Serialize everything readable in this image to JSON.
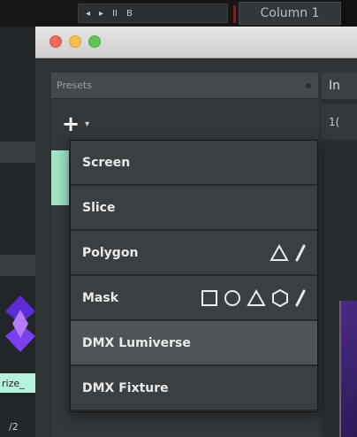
{
  "background": {
    "transport": {
      "prev": "◂",
      "next": "▸",
      "pause": "II",
      "stop": "B"
    },
    "column_tab": "Column 1",
    "left_tag": "rize_",
    "left_number": "/2",
    "right_header": "In",
    "right_value": "1("
  },
  "presets": {
    "header_label": "Presets",
    "add_symbol": "+",
    "add_caret": "▾"
  },
  "menu": {
    "items": [
      {
        "label": "Screen",
        "icons": []
      },
      {
        "label": "Slice",
        "icons": []
      },
      {
        "label": "Polygon",
        "icons": [
          "triangle-icon",
          "pencil-icon"
        ]
      },
      {
        "label": "Mask",
        "icons": [
          "square-icon",
          "circle-icon",
          "triangle-icon",
          "hexagon-icon",
          "pencil-icon"
        ]
      },
      {
        "label": "DMX Lumiverse",
        "icons": [],
        "highlighted": true
      },
      {
        "label": "DMX Fixture",
        "icons": []
      }
    ]
  },
  "colors": {
    "accent_mint": "#9fe6c8",
    "menu_bg": "#3b3f42",
    "menu_highlight": "#4e5356"
  }
}
